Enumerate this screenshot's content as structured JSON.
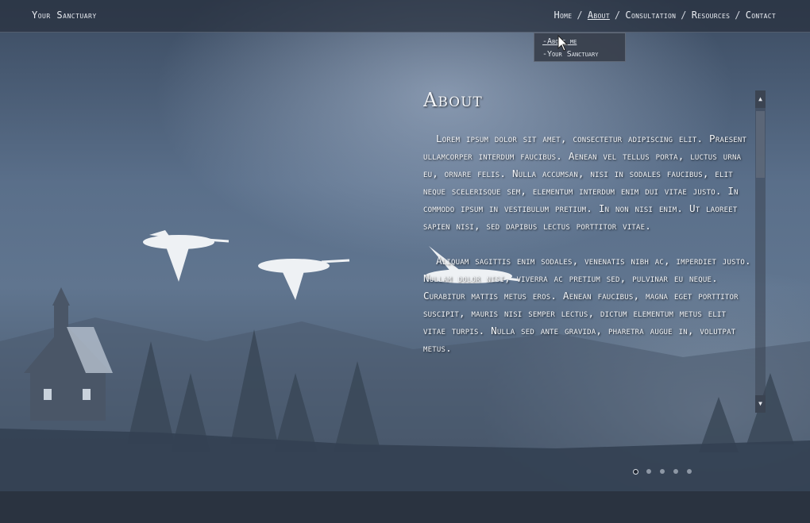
{
  "site": {
    "brand": "Your Sanctuary"
  },
  "nav": {
    "items": [
      "Home",
      "About",
      "Consultation",
      "Resources",
      "Contact"
    ],
    "separator": "/",
    "active_index": 1
  },
  "dropdown": {
    "items": [
      "-About me",
      "-Your Sanctuary"
    ]
  },
  "article": {
    "title": "About",
    "paragraphs": [
      "Lorem ipsum dolor sit amet, consectetur adipiscing elit. Praesent ullamcorper interdum faucibus. Aenean vel tellus porta, luctus urna eu, ornare felis. Nulla accumsan, nisi in sodales faucibus, elit neque scelerisque sem, elementum interdum enim dui vitae justo. In commodo ipsum in vestibulum pretium. In non nisi enim. Ut laoreet sapien nisi, sed dapibus lectus porttitor vitae.",
      "Aliquam sagittis enim sodales, venenatis nibh ac, imperdiet justo. Nullam dolor nisi, viverra ac pretium sed, pulvinar eu neque. Curabitur mattis metus eros. Aenean faucibus, magna eget porttitor suscipit, mauris nisi semper lectus, dictum elementum metus elit vitae turpis. Nulla sed ante gravida, pharetra augue in, volutpat metus."
    ]
  },
  "scrollbar": {
    "up_glyph": "▲",
    "down_glyph": "▼"
  },
  "slider": {
    "count": 5,
    "active_index": 0
  },
  "colors": {
    "topbar": "#28303e",
    "text": "#f3f5f8",
    "footer": "#28303c"
  }
}
